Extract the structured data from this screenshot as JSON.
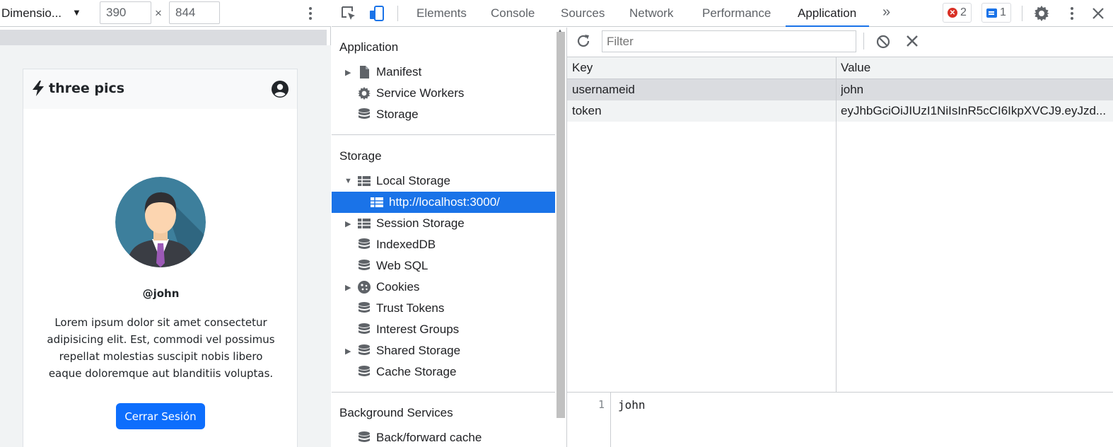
{
  "device_toolbar": {
    "dimensions_label": "Dimensio...",
    "width": "390",
    "height": "844",
    "times": "×"
  },
  "app": {
    "brand": "three pics",
    "username": "@john",
    "bio": "Lorem ipsum dolor sit amet consectetur adipisicing elit. Est, commodi vel possimus repellat molestias suscipit nobis libero eaque doloremque aut blanditiis voluptas.",
    "logout_label": "Cerrar Sesión",
    "button_color": "#0d6efd"
  },
  "devtools": {
    "tabs": [
      {
        "label": "Elements"
      },
      {
        "label": "Console"
      },
      {
        "label": "Sources"
      },
      {
        "label": "Network"
      },
      {
        "label": "Performance"
      },
      {
        "label": "Application",
        "active": true
      }
    ],
    "more_tabs": "»",
    "error_count": "2",
    "message_count": "1",
    "accent": "#1a73e8"
  },
  "sidebar": {
    "application_title": "Application",
    "application_items": [
      {
        "label": "Manifest",
        "icon": "file-icon",
        "expandable": true
      },
      {
        "label": "Service Workers",
        "icon": "gear-icon"
      },
      {
        "label": "Storage",
        "icon": "database-icon"
      }
    ],
    "storage_title": "Storage",
    "storage_items": [
      {
        "label": "Local Storage",
        "icon": "grid-icon",
        "expanded": true
      },
      {
        "label": "http://localhost:3000/",
        "icon": "grid-icon",
        "selected": true
      },
      {
        "label": "Session Storage",
        "icon": "grid-icon",
        "expandable": true
      },
      {
        "label": "IndexedDB",
        "icon": "database-icon"
      },
      {
        "label": "Web SQL",
        "icon": "database-icon"
      },
      {
        "label": "Cookies",
        "icon": "cookie-icon",
        "expandable": true
      },
      {
        "label": "Trust Tokens",
        "icon": "database-icon"
      },
      {
        "label": "Interest Groups",
        "icon": "database-icon"
      },
      {
        "label": "Shared Storage",
        "icon": "database-icon",
        "expandable": true
      },
      {
        "label": "Cache Storage",
        "icon": "database-icon"
      }
    ],
    "background_title": "Background Services",
    "background_items": [
      {
        "label": "Back/forward cache",
        "icon": "database-icon"
      }
    ]
  },
  "storage_view": {
    "filter_placeholder": "Filter",
    "columns": {
      "key": "Key",
      "value": "Value"
    },
    "rows": [
      {
        "key": "usernameid",
        "value": "john"
      },
      {
        "key": "token",
        "value": "eyJhbGciOiJIUzI1NiIsInR5cCI6IkpXVCJ9.eyJzd..."
      }
    ],
    "preview_line_number": "1",
    "preview_value": "john"
  }
}
